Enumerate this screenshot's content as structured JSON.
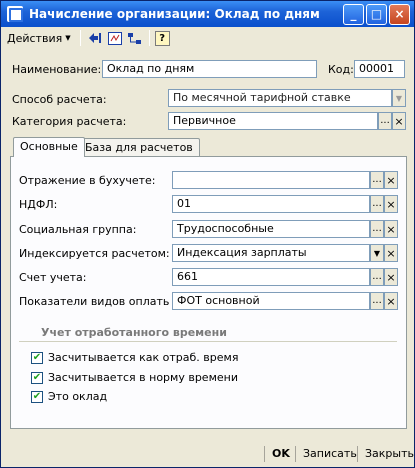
{
  "window": {
    "title": "Начисление организации: Оклад по дням",
    "controls": {
      "minimize": "_",
      "maximize": "□",
      "close": "×"
    }
  },
  "toolbar": {
    "actions_label": "Действия",
    "help_label": "?"
  },
  "form": {
    "name_label": "Наименование:",
    "name_value": "Оклад по дням",
    "code_label": "Код:",
    "code_value": "00001",
    "calc_method_label": "Способ расчета:",
    "calc_method_value": "По месячной тарифной ставке",
    "calc_category_label": "Категория расчета:",
    "calc_category_value": "Первичное"
  },
  "tabs": [
    {
      "label": "Основные"
    },
    {
      "label": "База для расчетов"
    }
  ],
  "main_tab": {
    "accounting_label": "Отражение в бухучете:",
    "accounting_value": "",
    "ndfl_label": "НДФЛ:",
    "ndfl_value": "01",
    "social_group_label": "Социальная группа:",
    "social_group_value": "Трудоспособные",
    "indexing_label": "Индексируется расчетом:",
    "indexing_value": "Индексация зарплаты",
    "account_label": "Счет учета:",
    "account_value": "661",
    "indicators_label": "Показатели видов оплаты т...",
    "indicators_value": "ФОТ основной",
    "worktime_group_title": "Учет отработанного времени",
    "checks": [
      {
        "label": "Засчитывается как отраб. время",
        "checked": true
      },
      {
        "label": "Засчитывается в норму времени",
        "checked": true
      },
      {
        "label": "Это оклад",
        "checked": true
      }
    ]
  },
  "buttons": {
    "ok": "OK",
    "save": "Записать",
    "close": "Закрыть"
  },
  "glyphs": {
    "select": "...",
    "clear": "×",
    "dropdown": "▼",
    "check": "✔"
  },
  "colors": {
    "titlebar": "#0a4fcc",
    "window_bg": "#ece9d8",
    "field_border": "#7f9db9"
  }
}
